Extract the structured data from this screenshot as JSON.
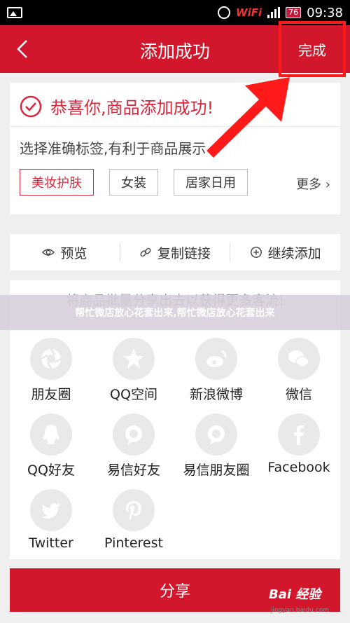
{
  "status_bar": {
    "wifi_text": "WiFi",
    "battery": "76",
    "time": "09:38"
  },
  "header": {
    "title": "添加成功",
    "done_label": "完成"
  },
  "success": {
    "message": "恭喜你,商品添加成功!",
    "tag_hint": "选择准确标签,有利于商品展示",
    "tags": [
      "美妆护肤",
      "女装",
      "居家日用"
    ],
    "more_label": "更多"
  },
  "actions": [
    {
      "label": "预览",
      "icon": "eye-icon"
    },
    {
      "label": "复制链接",
      "icon": "link-icon"
    },
    {
      "label": "继续添加",
      "icon": "plus-circle-icon"
    }
  ],
  "share": {
    "hint": "将商品批量分享出去以获得更多客流!",
    "items": [
      {
        "label": "朋友圈",
        "icon": "moments-icon"
      },
      {
        "label": "QQ空间",
        "icon": "qzone-icon"
      },
      {
        "label": "新浪微博",
        "icon": "weibo-icon"
      },
      {
        "label": "微信",
        "icon": "wechat-icon"
      },
      {
        "label": "QQ好友",
        "icon": "qq-icon"
      },
      {
        "label": "易信好友",
        "icon": "yixin-icon"
      },
      {
        "label": "易信朋友圈",
        "icon": "yixin-moments-icon"
      },
      {
        "label": "Facebook",
        "icon": "facebook-icon"
      },
      {
        "label": "Twitter",
        "icon": "twitter-icon"
      },
      {
        "label": "Pinterest",
        "icon": "pinterest-icon"
      }
    ],
    "button_label": "分享"
  },
  "banner": {
    "text": "帮忙微店放心花套出来,帮忙微店放心花套出来"
  },
  "watermark": {
    "text": "Bai 经验",
    "sub": "jingyan.baidu.com"
  },
  "colors": {
    "brand_red": "#d2172d",
    "accent_red": "#d9263b",
    "highlight_red": "#ff1a1a"
  }
}
